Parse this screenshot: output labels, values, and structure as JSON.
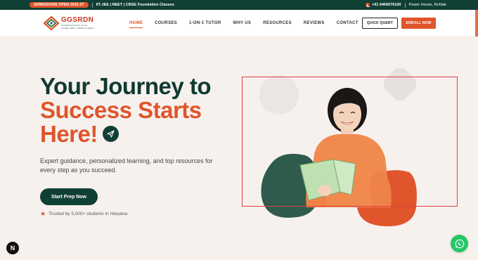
{
  "topbar": {
    "admissions": "ADMISSIONS OPEN 2026-27",
    "courses": "IIT-JEE | NEET | CBSE Foundation Classes",
    "phone": "+91 9466076100",
    "location": "Power House, Rohtak"
  },
  "logo": {
    "name": "GGSRDN",
    "sub": "GGSRDN Education Centre",
    "tagline": "IIT-JEE | NEET | CBSE Foundation"
  },
  "nav": {
    "items": [
      "HOME",
      "COURSES",
      "1-ON-1 TUTOR",
      "WHY US",
      "RESOURCES",
      "REVIEWS",
      "CONTACT"
    ],
    "active": "HOME",
    "quick_query": "QUICK QUERY",
    "enroll": "ENROLL NOW"
  },
  "hero": {
    "line1": "Your Journey to",
    "line2": "Success Starts",
    "line3": "Here!",
    "description": "Expert guidance, personalized learning, and top resources for every step as you succeed.",
    "cta": "Start Prep Now",
    "trusted": "Trusted by 5,000+ students in Haryana"
  },
  "badges": {
    "next": "N"
  },
  "colors": {
    "primary_dark": "#103f35",
    "accent_orange": "#e0552b",
    "background": "#f7f1ee",
    "whatsapp": "#25c665"
  }
}
